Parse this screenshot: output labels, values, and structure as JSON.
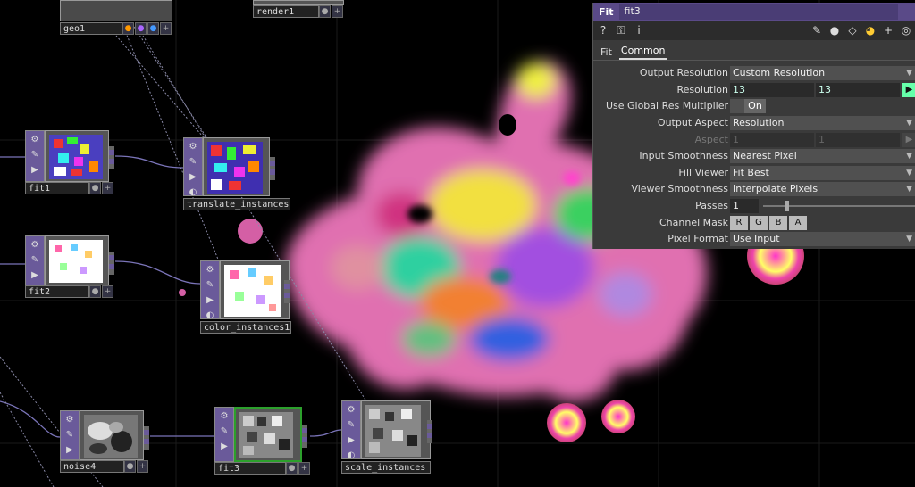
{
  "nodes": {
    "geo1": "geo1",
    "render1": "render1",
    "fit1": "fit1",
    "translate_instances": "translate_instances",
    "fit2": "fit2",
    "color_instances1": "color_instances1",
    "noise4": "noise4",
    "fit3": "fit3",
    "scale_instances": "scale_instances"
  },
  "colors": {
    "node_side": "#6a5a9a",
    "selected_border": "#2ca02c",
    "panel_title": "#5a4a88",
    "go_button": "#6fa"
  },
  "panel": {
    "op_type": "Fit",
    "op_name": "fit3",
    "icons": [
      "help-icon",
      "python-help-icon",
      "info-icon",
      "pencil-icon",
      "comment-icon",
      "eraser-icon",
      "python-icon",
      "plus-icon",
      "target-icon"
    ],
    "help_glyph": "?",
    "info_glyph": "i",
    "tabs": [
      "Fit",
      "Common"
    ],
    "active_tab": "Common",
    "params": {
      "output_resolution": {
        "label": "Output Resolution",
        "value": "Custom Resolution"
      },
      "resolution": {
        "label": "Resolution",
        "w": "13",
        "h": "13"
      },
      "global_res": {
        "label": "Use Global Res Multiplier",
        "value": "On"
      },
      "output_aspect": {
        "label": "Output Aspect",
        "value": "Resolution"
      },
      "aspect": {
        "label": "Aspect",
        "a": "1",
        "b": "1"
      },
      "input_smoothness": {
        "label": "Input Smoothness",
        "value": "Nearest Pixel"
      },
      "fill_viewer": {
        "label": "Fill Viewer",
        "value": "Fit Best"
      },
      "viewer_smoothness": {
        "label": "Viewer Smoothness",
        "value": "Interpolate Pixels"
      },
      "passes": {
        "label": "Passes",
        "value": "1"
      },
      "channel_mask": {
        "label": "Channel Mask",
        "channels": [
          "R",
          "G",
          "B",
          "A"
        ]
      },
      "pixel_format": {
        "label": "Pixel Format",
        "value": "Use Input"
      }
    }
  }
}
